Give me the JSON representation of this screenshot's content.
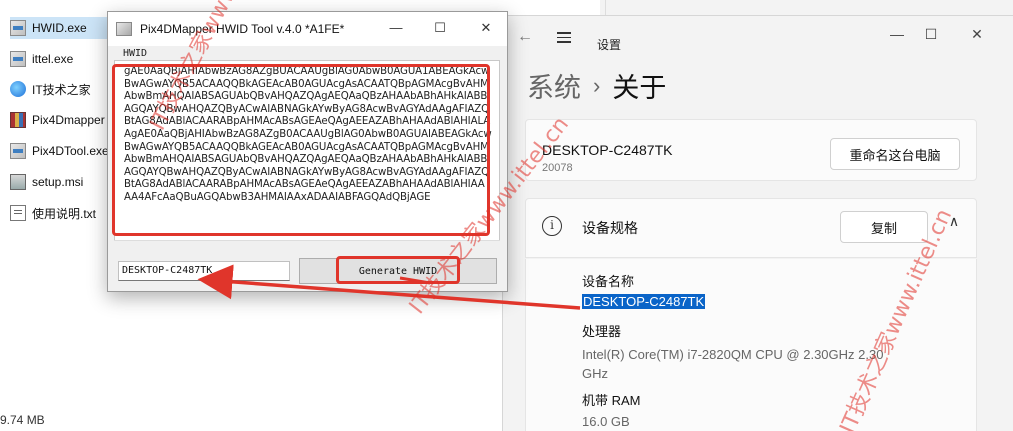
{
  "explorer": {
    "files": [
      {
        "name": "HWID.exe",
        "icon": "exe-icon",
        "selected": true
      },
      {
        "name": "ittel.exe",
        "icon": "exe-icon"
      },
      {
        "name": "IT技术之家",
        "icon": "ie-icon"
      },
      {
        "name": "Pix4Dmapper",
        "icon": "rar-icon"
      },
      {
        "name": "Pix4DTool.exe",
        "icon": "exe-icon"
      },
      {
        "name": "setup.msi",
        "icon": "msi-icon"
      },
      {
        "name": "使用说明.txt",
        "icon": "txt-icon"
      }
    ],
    "status_size": "9.74 MB"
  },
  "hwid_tool": {
    "title": "Pix4DMapper HWID Tool v.4.0 *A1FE*",
    "hwid_label": "HWID",
    "hwid_text": "gAE0AaQBjAHIAbwBzAG8AZgBUACAAUgBlAG0AbwB0AGUA1ABEAGkAcwBwAGwAYQB5ACAAQQBkAGEAcAB0AGUAcgAsACAATQBpAGMAcgBvAHMAbwBmAHQAIABSAGUAbQBvAHQAZQAgAEQAaQBzAHAAbABhAHkAIABBAGQAYQBwAHQAZQByACwAIABNAGkAYwByAG8AcwBvAGYAdAAgAFIAZQBtAG8AdABlACAARABpAHMAcABsAGEAeQAgAEEAZABhAHAAdABlAHIALAAgAE0AaQBjAHIAbwBzAG8AZgB0ACAAUgBlAG0AbwB0AGUAIABEAGkAcwBwAGwAYQB5ACAAQQBkAGEAcAB0AGUAcgAsACAATQBpAGMAcgBvAHMAbwBmAHQAIABSAGUAbQBvAHQAZQAgAEQAaQBzAHAAbABhAHkAIABBAGQAYQBwAHQAZQByACwAIABNAGkAYwByAG8AcwBvAGYAdAAgAFIAZQBtAG8AdABlACAARABpAHMAcABsAGEAeQAgAEEAZABhAHAAdABlAHIAAAA4AFcAaQBuAGQAbwB3AHMAIAAxADAAIABFAGQAdQBjAGE",
    "device_value": "DESKTOP-C2487TK",
    "generate_label": "Generate HWID"
  },
  "settings": {
    "window_title": "设置",
    "breadcrumb_parent": "系统",
    "breadcrumb_sep": "›",
    "breadcrumb_current": "关于",
    "device_name": "DESKTOP-C2487TK",
    "device_sub": "20078",
    "rename_label": "重命名这台电脑",
    "spec_title": "设备规格",
    "copy_label": "复制",
    "specs": [
      {
        "label": "设备名称",
        "value": "DESKTOP-C2487TK"
      },
      {
        "label": "处理器",
        "value": "Intel(R) Core(TM) i7-2820QM CPU @ 2.30GHz   2.30 GHz"
      },
      {
        "label": "机带 RAM",
        "value": "16.0 GB"
      }
    ]
  },
  "watermarks": [
    "IT技术之家www.ittel.cn"
  ],
  "colors": {
    "annotation_red": "#e0352b",
    "selection_blue": "#0a64c8"
  }
}
